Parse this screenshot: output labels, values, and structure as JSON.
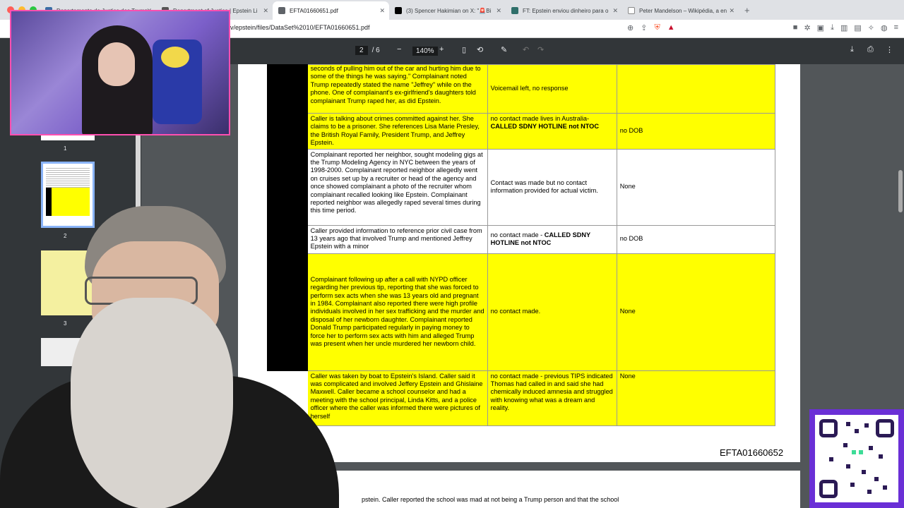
{
  "browser": {
    "tabs": [
      {
        "title": "Departamento de Justiça dos Trump",
        "active": false
      },
      {
        "title": "Department of Justice | Epstein Li",
        "active": false
      },
      {
        "title": "EFTA01660651.pdf",
        "active": true
      },
      {
        "title": "(3) Spencer Hakimian on X: \"🚨Bi",
        "active": false
      },
      {
        "title": "FT: Epstein enviou dinheiro para o",
        "active": false
      },
      {
        "title": "Peter Mandelson – Wikipédia, a en",
        "active": false
      }
    ],
    "new_tab": "+",
    "url": "v/epstein/files/DataSet%2010/EFTA01660651.pdf"
  },
  "pdf_toolbar": {
    "page_current": "2",
    "page_total": "/ 6",
    "zoom": "140%",
    "zoom_out": "−",
    "zoom_in": "+"
  },
  "thumbnails": [
    {
      "label": "1"
    },
    {
      "label": "2"
    },
    {
      "label": "3"
    }
  ],
  "table": {
    "rows": [
      {
        "complaint": "seconds of pulling him out of the car and hurting him due to some of the things he was saying.\" Complainant noted Trump repeatedly stated the name \"Jeffrey\" while on the phone. One of complainant's ex-girlfriend's daughters told complainant Trump raped her, as did Epstein.",
        "contact": "Voicemail left, no response",
        "contact_bold": "",
        "dob": "",
        "yellow": true
      },
      {
        "complaint": "Caller is talking about crimes committed against her. She claims to be a prisoner. She references Lisa Marie Presley, the British Royal Family, President Trump, and Jeffrey Epstein.",
        "contact": "no contact made lives in Australia-",
        "contact_bold": "CALLED SDNY HOTLINE not NTOC",
        "dob": "no DOB",
        "yellow": true
      },
      {
        "complaint": "Complainant reported her neighbor, sought modeling gigs at the Trump Modeling Agency in NYC between the years of 1998-2000. Complainant reported neighbor allegedly went on cruises set up by a recruiter or head of the agency and once showed complainant a photo of the recruiter whom complainant recalled looking like Epstein. Complainant reported neighbor was allegedly raped several times during this time period.",
        "contact": "Contact was made but no contact information provided for actual victim.",
        "contact_bold": "",
        "dob": "None",
        "yellow": false
      },
      {
        "complaint": "Caller provided information to reference prior civil case from 13 years ago that involved Trump and mentioned Jeffrey Epstein with a minor",
        "contact": "no contact made -",
        "contact_bold": "CALLED SDNY HOTLINE not NTOC",
        "dob": "no DOB",
        "yellow": false
      },
      {
        "complaint": "Complainant following up after a call with NYPD officer regarding her previous tip, reporting that she was forced to perform sex acts when she was 13 years old and pregnant in 1984. Complainant also reported there were high profile individuals involved in her sex trafficking and the murder and disposal of her newborn daughter. Complainant reported Donald Trump participated regularly in paying money to force her to perform sex acts with him and alleged Trump was present when her uncle murdered her newborn child.",
        "contact": "no contact made.",
        "contact_bold": "",
        "dob": "None",
        "yellow": true
      },
      {
        "complaint": "Caller was taken by boat to Epstein's Island. Caller said it was complicated and involved Jeffery Epstein and Ghislaine Maxwell. Caller became a school counselor and had a meeting with the school principal, Linda Kitts, and a police officer where the caller was informed there were pictures of herself",
        "contact": "no contact made - previous TIPS indicated Thomas had called in and said she had chemically induced amnesia and struggled with knowing what was a dream and reality.",
        "contact_bold": "",
        "dob": "None",
        "yellow": true
      }
    ]
  },
  "page_footer_id": "EFTA01660652",
  "next_page_text": "pstein. Caller reported the school was mad at not being a Trump person and that the school"
}
